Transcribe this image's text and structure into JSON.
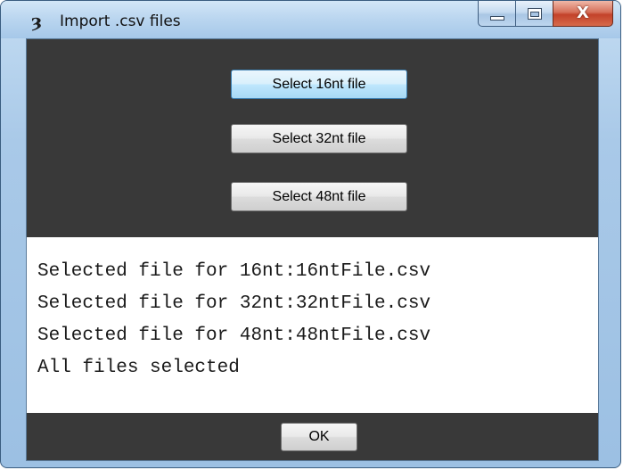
{
  "window": {
    "title": "Import .csv files",
    "app_icon_glyph": "ȝ",
    "controls": {
      "minimize_icon": "minimize-icon",
      "maximize_icon": "maximize-icon",
      "close_label": "X"
    }
  },
  "buttons": {
    "select_16": "Select 16nt file",
    "select_32": "Select 32nt file",
    "select_48": "Select 48nt file",
    "ok": "OK"
  },
  "output": {
    "lines": [
      "Selected file for 16nt:16ntFile.csv",
      "Selected file for 32nt:32ntFile.csv",
      "Selected file for 48nt:48ntFile.csv",
      "All files selected"
    ]
  },
  "colors": {
    "client_background": "#393939",
    "title_bar": "#b9d5ef",
    "close_button": "#c3422a",
    "focused_button_border": "#3c7fb1"
  }
}
